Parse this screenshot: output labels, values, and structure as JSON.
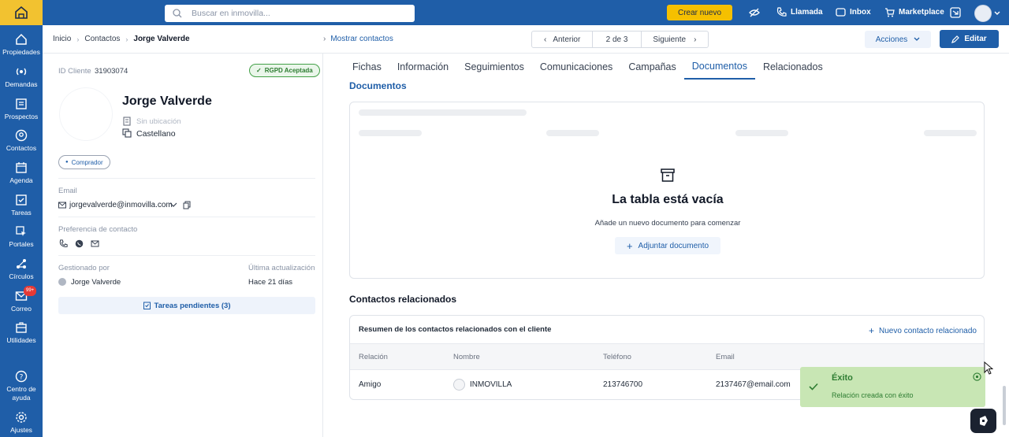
{
  "sidebar": {
    "items": [
      {
        "label": "Propiedades",
        "icon": "home-icon"
      },
      {
        "label": "Demandas",
        "icon": "signal-icon"
      },
      {
        "label": "Prospectos",
        "icon": "list-icon"
      },
      {
        "label": "Contactos",
        "icon": "contact-icon"
      },
      {
        "label": "Agenda",
        "icon": "calendar-icon"
      },
      {
        "label": "Tareas",
        "icon": "checkbox-icon"
      },
      {
        "label": "Portales",
        "icon": "cursor-icon"
      },
      {
        "label": "Círculos",
        "icon": "network-icon"
      },
      {
        "label": "Correo",
        "icon": "mail-icon",
        "badge": "99+"
      },
      {
        "label": "Utilidades",
        "icon": "toolbox-icon"
      }
    ],
    "help_label": "Centro de ayuda",
    "settings_label": "Ajustes"
  },
  "topbar": {
    "search_placeholder": "Buscar en inmovilla...",
    "create_label": "Crear nuevo",
    "call_label": "Llamada",
    "inbox_label": "Inbox",
    "marketplace_label": "Marketplace"
  },
  "subheader": {
    "breadcrumb": [
      "Inicio",
      "Contactos",
      "Jorge Valverde"
    ],
    "show_contacts": "Mostrar contactos",
    "prev_label": "Anterior",
    "page_indicator": "2 de 3",
    "next_label": "Siguiente",
    "actions_label": "Acciones",
    "edit_label": "Editar"
  },
  "client": {
    "id_label": "ID Cliente",
    "id_value": "31903074",
    "rgpd": "RGPD Aceptada",
    "name": "Jorge Valverde",
    "location": "Sin ubicación",
    "language": "Castellano",
    "tag": "Comprador",
    "email_label": "Email",
    "email": "jorgevalverde@inmovilla.com",
    "contact_pref_label": "Preferencia de contacto",
    "managed_by_label": "Gestionado por",
    "managed_by": "Jorge Valverde",
    "last_update_label": "Última actualización",
    "last_update": "Hace 21 días",
    "pending_tasks": "Tareas pendientes (3)"
  },
  "tabs": [
    "Fichas",
    "Información",
    "Seguimientos",
    "Comunicaciones",
    "Campañas",
    "Documentos",
    "Relacionados"
  ],
  "active_tab": "Documentos",
  "documents": {
    "title": "Documentos",
    "empty_title": "La tabla está vacía",
    "empty_subtitle": "Añade un nuevo documento para comenzar",
    "attach_label": "Adjuntar documento"
  },
  "related": {
    "title": "Contactos relacionados",
    "summary": "Resumen de los contactos relacionados con el cliente",
    "new_label": "Nuevo contacto relacionado",
    "columns": [
      "Relación",
      "Nombre",
      "Teléfono",
      "Email"
    ],
    "rows": [
      {
        "relation": "Amigo",
        "name": "INMOVILLA",
        "phone": "213746700",
        "email": "2137467@email.com"
      }
    ]
  },
  "toast": {
    "title": "Éxito",
    "message": "Relación creada con éxito"
  },
  "colors": {
    "primary": "#1f5ea8",
    "accent": "#f5c000",
    "success_bg": "#c8e6b4",
    "success_text": "#2e7d32"
  }
}
